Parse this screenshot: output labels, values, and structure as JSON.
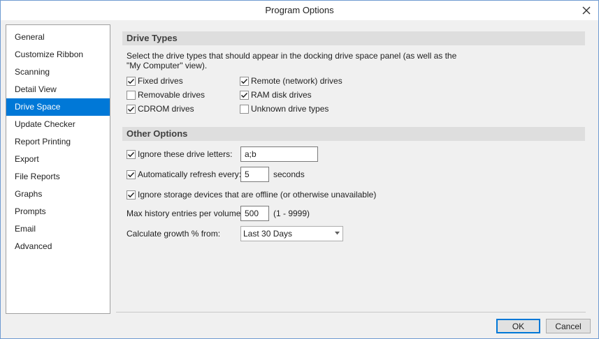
{
  "window": {
    "title": "Program Options"
  },
  "sidebar": {
    "items": [
      {
        "label": "General"
      },
      {
        "label": "Customize Ribbon"
      },
      {
        "label": "Scanning"
      },
      {
        "label": "Detail View"
      },
      {
        "label": "Drive Space",
        "selected": true
      },
      {
        "label": "Update Checker"
      },
      {
        "label": "Report Printing"
      },
      {
        "label": "Export"
      },
      {
        "label": "File Reports"
      },
      {
        "label": "Graphs"
      },
      {
        "label": "Prompts"
      },
      {
        "label": "Email"
      },
      {
        "label": "Advanced"
      }
    ]
  },
  "drive_types": {
    "header": "Drive Types",
    "description": "Select the drive types that should appear in the docking drive space panel (as well as the \"My Computer\" view).",
    "options": [
      {
        "label": "Fixed drives",
        "checked": true
      },
      {
        "label": "Removable drives",
        "checked": false
      },
      {
        "label": "CDROM drives",
        "checked": true
      },
      {
        "label": "Remote (network) drives",
        "checked": true
      },
      {
        "label": "RAM disk drives",
        "checked": true
      },
      {
        "label": "Unknown drive types",
        "checked": false
      }
    ]
  },
  "other_options": {
    "header": "Other Options",
    "ignore_letters": {
      "label": "Ignore these drive letters:",
      "checked": true,
      "value": "a;b"
    },
    "auto_refresh": {
      "label": "Automatically refresh every:",
      "checked": true,
      "value": "5",
      "unit": "seconds"
    },
    "ignore_offline": {
      "label": "Ignore storage devices that are offline (or otherwise unavailable)",
      "checked": true
    },
    "max_history": {
      "label": "Max history entries per volume:",
      "value": "500",
      "range": "(1 - 9999)"
    },
    "growth": {
      "label": "Calculate growth % from:",
      "selected": "Last 30 Days"
    }
  },
  "buttons": {
    "ok": "OK",
    "cancel": "Cancel"
  },
  "colors": {
    "accent": "#0078d7",
    "section_header_bg": "#dedede",
    "window_border": "#6f9bd1"
  }
}
